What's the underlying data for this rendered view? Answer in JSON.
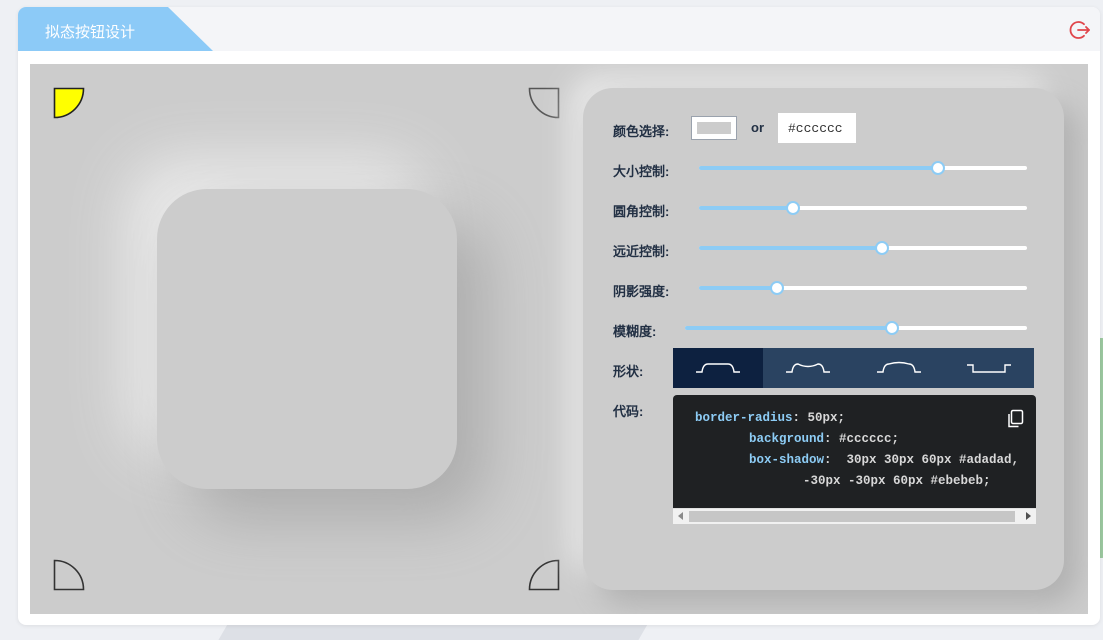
{
  "window": {
    "title": "拟态按钮设计",
    "exit_icon": "exit-icon"
  },
  "colors": {
    "accent": "#8dccf5",
    "background": "#cccccc",
    "corner_active": "#ffff00",
    "shape_active": "#0d2140",
    "shape_inactive": "#2a4361",
    "code_bg": "#1f2123"
  },
  "corners": [
    {
      "name": "corner-top-left",
      "active": true
    },
    {
      "name": "corner-top-right",
      "active": false
    },
    {
      "name": "corner-bottom-left",
      "active": false
    },
    {
      "name": "corner-bottom-right",
      "active": false
    }
  ],
  "panel": {
    "color_label": "颜色选择:",
    "or_label": "or",
    "hex_value": "#cccccc",
    "sliders": [
      {
        "key": "size",
        "label": "大小控制:",
        "value": 0.725
      },
      {
        "key": "radius",
        "label": "圆角控制:",
        "value": 0.285
      },
      {
        "key": "distance",
        "label": "远近控制:",
        "value": 0.555
      },
      {
        "key": "intensity",
        "label": "阴影强度:",
        "value": 0.235
      },
      {
        "key": "blur",
        "label": "模糊度:",
        "value": 0.602
      }
    ],
    "shape_label": "形状:",
    "shapes": [
      {
        "key": "flat",
        "active": true
      },
      {
        "key": "concave",
        "active": false
      },
      {
        "key": "convex",
        "active": false
      },
      {
        "key": "pressed",
        "active": false
      }
    ],
    "code_label": "代码:",
    "code": {
      "radius_key": "border-radius",
      "radius_val": "50px;",
      "bg_key": "background",
      "bg_val": "#cccccc;",
      "shadow_key": "box-shadow",
      "shadow_val1": "30px 30px 60px #adadad,",
      "shadow_val2": "-30px -30px 60px #ebebeb;"
    }
  }
}
